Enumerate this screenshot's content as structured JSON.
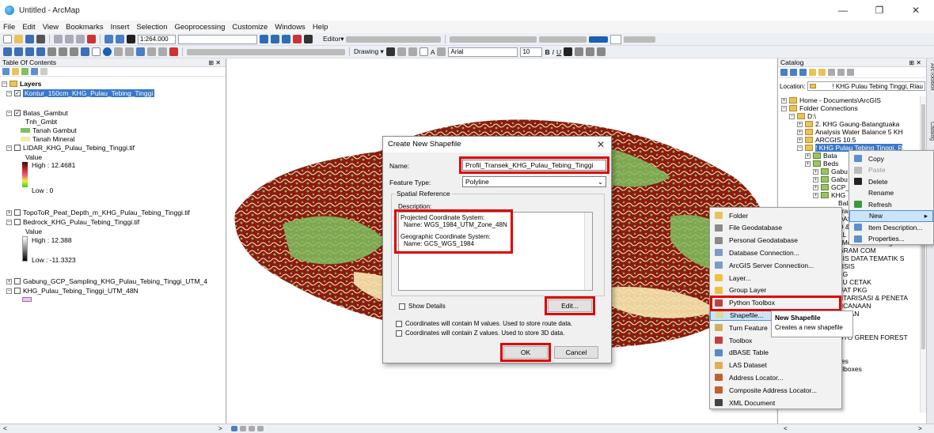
{
  "window": {
    "title": "Untitled - ArcMap",
    "controls": [
      "—",
      "❐",
      "✕"
    ]
  },
  "menu": [
    "File",
    "Edit",
    "View",
    "Bookmarks",
    "Insert",
    "Selection",
    "Geoprocessing",
    "Customize",
    "Windows",
    "Help"
  ],
  "toolbar": {
    "scale": "1:264.000",
    "editor_label": "Editor▾",
    "drawing_label": "Drawing ▾",
    "font_name": "Arial",
    "font_size": "10",
    "bold": "B",
    "italic": "I",
    "underline": "U",
    "text_tool": "A"
  },
  "toc": {
    "title": "Table Of Contents",
    "pin": "⊞ ✕",
    "layers_root": "Layers",
    "items": [
      {
        "label": "Kontur_150cm_KHG_Pulau_Tebing_Tinggi",
        "selected": true
      },
      {
        "label": "Batas_Gambut"
      },
      {
        "label": "Tnh_Gmbt"
      },
      {
        "label": "Tanah Gambut",
        "color": "#7fbf5f"
      },
      {
        "label": "Tanah Mineral",
        "color": "#f7e7b0"
      },
      {
        "label": "LIDAR_KHG_Pulau_Tebing_Tinggi.tif"
      },
      {
        "label": "Value"
      },
      {
        "label": "High : 12.4681"
      },
      {
        "label": "Low : 0"
      },
      {
        "label": "TopoToR_Peat_Depth_m_KHG_Pulau_Tebing_Tinggi.tif"
      },
      {
        "label": "Bedrock_KHG_Pulau_Tebing_Tinggi.tif"
      },
      {
        "label": "Value"
      },
      {
        "label": "High : 12.388"
      },
      {
        "label": "Low : -11.3323"
      },
      {
        "label": "Gabung_GCP_Sampling_KHG_Pulau_Tebing_Tinggi_UTM_4"
      },
      {
        "label": "KHG_Pulau_Tebing_Tinggi_UTM_48N"
      }
    ]
  },
  "catalog": {
    "title": "Catalog",
    "pin": "⊞ ✕",
    "location_label": "Location:",
    "location_value": "! KHG Pulau Tebing Tinggi, Riau",
    "tree": [
      "Home - Documents\\ArcGIS",
      "Folder Connections",
      "D:\\",
      "2. KHG Gaung-Batangtuaka",
      "Analysis Water Balance 5 KH",
      "ARCGIS 10.5",
      "! KHG Pulau Tebing Tinggi, R",
      "Bata",
      "Beds",
      "Gabu",
      "Gabu",
      "GCP_",
      "KHG",
      "Balance",
      "uran & Perundangan",
      "DASAR",
      "O & VIDEO",
      "EL DRAW",
      "t Memo & Undangan",
      "GRAM COM",
      "SIS DATA TEMATIK S",
      "LISIS",
      "KG",
      "KU CETAK",
      "UAT PKG",
      "NTARISASI & PENETA",
      "NCANAAN",
      "UIHAN",
      "lder",
      "OTO GREEN FOREST",
      "F:\\",
      "Toolboxes",
      "My Toolboxes",
      "System Toolboxes"
    ],
    "side_tabs": [
      "ArcToolbox",
      "Catalog"
    ]
  },
  "dialog": {
    "title": "Create New Shapefile",
    "close": "✕",
    "name_label": "Name:",
    "name_value": "Profil_Transek_KHG_Pulau_Tebing_Tinggi",
    "feature_type_label": "Feature Type:",
    "feature_type_value": "Polyline",
    "spatial_ref_label": "Spatial Reference",
    "description_label": "Description:",
    "projected_label": "Projected Coordinate System:",
    "projected_name": "Name: WGS_1984_UTM_Zone_48N",
    "geographic_label": "Geographic Coordinate System:",
    "geographic_name": "Name: GCS_WGS_1984",
    "show_details": "Show Details",
    "edit_button": "Edit...",
    "m_values": "Coordinates will contain M values. Used to store route data.",
    "z_values": "Coordinates will contain Z values. Used to store 3D data.",
    "ok": "OK",
    "cancel": "Cancel"
  },
  "context_menu_1": [
    {
      "label": "Copy",
      "icon": "copy-icon"
    },
    {
      "label": "Paste",
      "icon": "paste-icon",
      "disabled": true
    },
    {
      "label": "Delete",
      "icon": "delete-icon"
    },
    {
      "label": "Rename",
      "icon": ""
    },
    {
      "label": "Refresh",
      "icon": "refresh-icon"
    },
    {
      "label": "New",
      "icon": "",
      "highlight": true,
      "submenu": "▸"
    },
    {
      "label": "Item Description...",
      "icon": "item-description-icon"
    },
    {
      "label": "Properties...",
      "icon": "properties-icon"
    }
  ],
  "context_menu_2": [
    {
      "label": "Folder",
      "icon": "folder-icon",
      "color": "#e8c35c"
    },
    {
      "label": "File Geodatabase",
      "icon": "file-geodatabase-icon",
      "color": "#8a8a8a"
    },
    {
      "label": "Personal Geodatabase",
      "icon": "personal-geodatabase-icon",
      "color": "#8a8a8a"
    },
    {
      "label": "Database Connection...",
      "icon": "database-connection-icon",
      "color": "#7a9cc6"
    },
    {
      "label": "ArcGIS Server Connection...",
      "icon": "server-connection-icon",
      "color": "#7a9cc6"
    },
    {
      "label": "Layer...",
      "icon": "layer-icon",
      "color": "#f0c040"
    },
    {
      "label": "Group Layer",
      "icon": "group-layer-icon",
      "color": "#f0c040"
    },
    {
      "label": "Python Toolbox",
      "icon": "python-toolbox-icon",
      "color": "#c04040"
    },
    {
      "label": "Shapefile...",
      "icon": "shapefile-icon",
      "color": "#d0e0a0",
      "highlight": true
    },
    {
      "label": "Turn Feature",
      "icon": "turn-feature-icon",
      "color": "#d0b060"
    },
    {
      "label": "Toolbox",
      "icon": "toolbox-icon",
      "color": "#c04040"
    },
    {
      "label": "dBASE Table",
      "icon": "dbase-table-icon",
      "color": "#5a8ac6"
    },
    {
      "label": "LAS Dataset",
      "icon": "las-dataset-icon",
      "color": "#e0b050"
    },
    {
      "label": "Address Locator...",
      "icon": "address-locator-icon",
      "color": "#c06030"
    },
    {
      "label": "Composite Address Locator...",
      "icon": "composite-locator-icon",
      "color": "#c06030"
    },
    {
      "label": "XML Document",
      "icon": "xml-document-icon",
      "color": "#444444"
    }
  ],
  "tooltip": {
    "title": "New Shapefile",
    "text": "Creates a new shapefile"
  },
  "status": {
    "scroll_left": "<",
    "scroll_right": ">"
  }
}
